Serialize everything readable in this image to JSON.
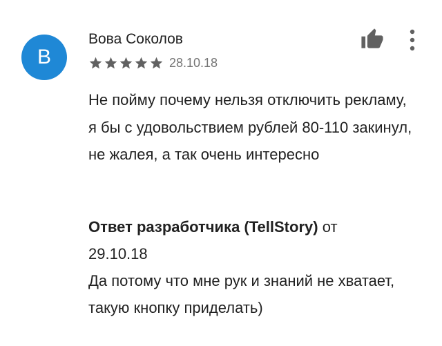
{
  "review": {
    "avatar_letter": "B",
    "avatar_color": "#1f88d6",
    "author": "Вова Соколов",
    "rating": 5,
    "date": "28.10.18",
    "text": "Не пойму почему нельзя отключить рекламу, я бы с удовольствием рублей 80-110 закинул, не жалея, а так очень интересно"
  },
  "reply": {
    "header": "Ответ разработчика (TellStory)",
    "from_word": " от",
    "date": "29.10.18",
    "text": "Да потому что мне рук и знаний не хватает, такую кнопку приделать)"
  },
  "icons": {
    "like": "thumbs-up-icon",
    "more": "more-vert-icon"
  }
}
